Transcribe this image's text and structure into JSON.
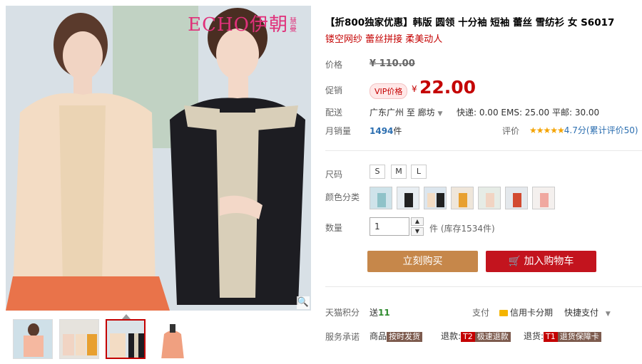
{
  "gallery": {
    "brand_text": "ECHO伊朝",
    "brand_sub": "慧曼",
    "thumb_count": 4,
    "selected_thumb_index": 2
  },
  "product": {
    "title": "【折800独家优惠】韩版 圆领 十分袖 短袖 蕾丝 雪纺衫 女 S6017",
    "subtitle": "镂空网纱 蕾丝拼接 柔美动人"
  },
  "price": {
    "label": "价格",
    "original": "¥ 110.00",
    "promo_label": "促销",
    "vip_badge": "VIP价格",
    "currency": "¥",
    "promo_value": "22.00"
  },
  "shipping": {
    "label": "配送",
    "route": "广东广州 至 廊坊",
    "fees": "快递: 0.00 EMS: 25.00 平邮: 30.00"
  },
  "sales": {
    "label": "月销量",
    "count": "1494",
    "unit": "件",
    "rating_label": "评价",
    "stars": "★★★★★",
    "rating_text": "4.7分(累计评价50)"
  },
  "options": {
    "size_label": "尺码",
    "sizes": [
      "S",
      "M",
      "L"
    ],
    "color_label": "颜色分类",
    "swatch_count": 7
  },
  "quantity": {
    "label": "数量",
    "value": "1",
    "stock_text": "件 (库存1534件)"
  },
  "actions": {
    "buy_now": "立刻购买",
    "add_to_cart": "加入购物车"
  },
  "footer": {
    "points_label": "天猫积分",
    "points_text": "送",
    "points_value": "11",
    "pay_label": "支付",
    "credit_pay": "信用卡分期",
    "quick_pay": "快捷支付",
    "service_label": "服务承诺",
    "service_1_prefix": "商品",
    "service_1_tag": "按时发货",
    "service_2_prefix": "退款:",
    "service_2_code": "T2",
    "service_2_tag": "极速退款",
    "service_3_prefix": "退货:",
    "service_3_code": "T1",
    "service_3_tag": "退货保障卡"
  },
  "colors": {
    "price_red": "#c40000",
    "buy_button": "#c6874a",
    "cart_button": "#c3141e",
    "link_blue": "#2b6eb0"
  }
}
